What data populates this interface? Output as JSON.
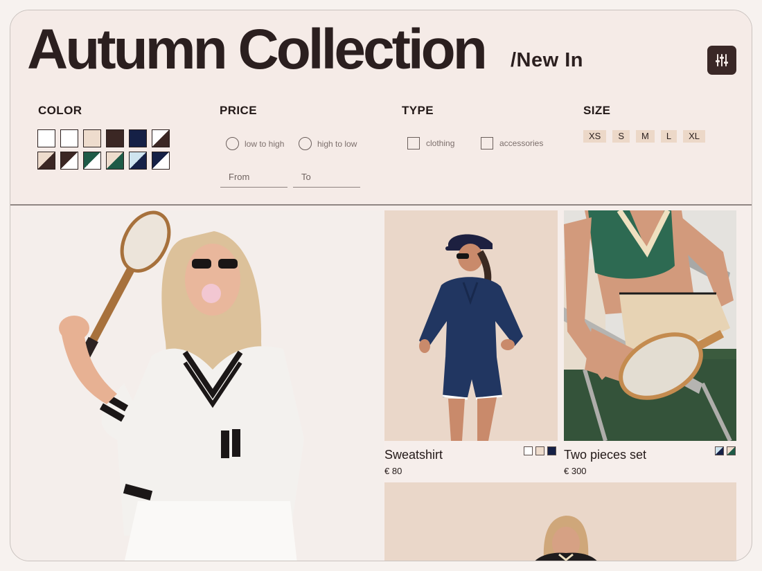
{
  "header": {
    "title": "Autumn Collection",
    "subtitle": "/New In"
  },
  "filters": {
    "color": {
      "label": "COLOR"
    },
    "price": {
      "label": "PRICE",
      "sort_options": [
        "low to high",
        "high to low"
      ],
      "from_placeholder": "From",
      "to_placeholder": "To"
    },
    "type": {
      "label": "TYPE",
      "options": [
        "clothing",
        "accessories"
      ]
    },
    "size": {
      "label": "SIZE",
      "options": [
        "XS",
        "S",
        "M",
        "L",
        "XL"
      ]
    }
  },
  "swatch_colors": {
    "white": "#ffffff",
    "beige": "#eedccd",
    "dark_brown": "#3b2724",
    "navy": "#152046",
    "green": "#1e5a47",
    "light_blue": "#cfe4ef"
  },
  "products": [
    {
      "name": "Sweatshirt",
      "price": "€ 80"
    },
    {
      "name": "Two pieces set",
      "price": "€ 300"
    }
  ],
  "icons": {
    "filter_button": "sliders-icon"
  }
}
